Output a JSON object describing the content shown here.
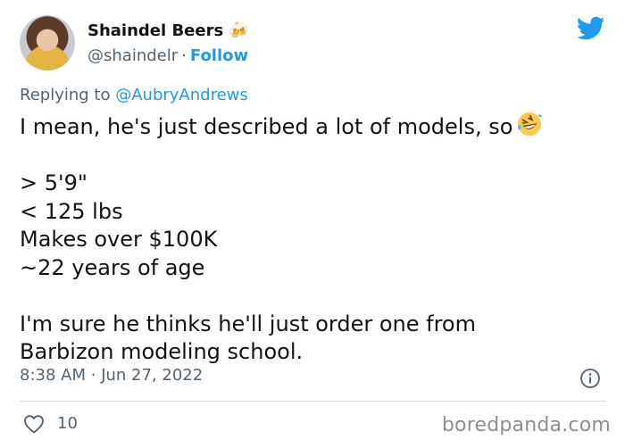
{
  "author": {
    "name": "Shaindel Beers",
    "name_emoji": "🍻",
    "handle": "@shaindelr",
    "separator": "·",
    "follow_label": "Follow"
  },
  "reply": {
    "prefix": "Replying to",
    "mention": "@AubryAndrews"
  },
  "tweet": {
    "lines": [
      "I mean, he's just described a lot of models, so",
      "",
      "> 5'9\"",
      "< 125 lbs",
      "Makes over $100K",
      "~22 years of age",
      "",
      "I'm sure he thinks he'll just order one from",
      "Barbizon modeling school."
    ]
  },
  "meta": {
    "time": "8:38 AM",
    "separator": "·",
    "date": "Jun 27, 2022"
  },
  "engagement": {
    "likes": "10"
  },
  "watermark": "boredpanda.com",
  "icons": {
    "brand": "twitter-bird-icon",
    "emoji": "rolling-on-floor-laughing-icon",
    "info": "info-icon",
    "like": "heart-icon"
  },
  "colors": {
    "accent": "#1d9bf0",
    "text": "#0f1419",
    "secondary": "#536471"
  }
}
